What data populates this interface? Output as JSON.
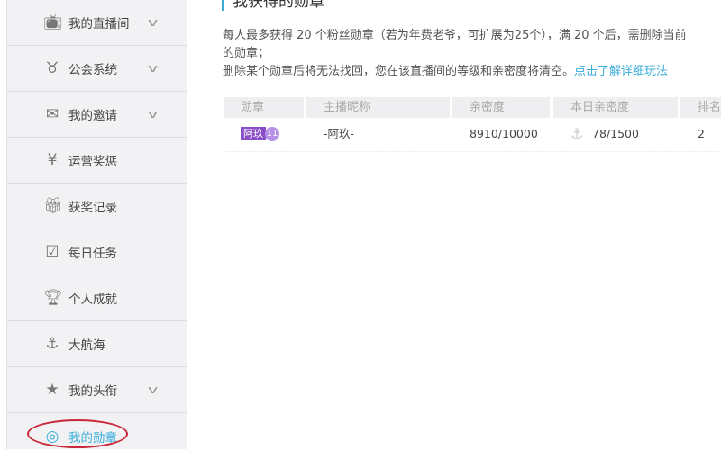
{
  "sidebar": {
    "items": [
      {
        "label": "我的直播间",
        "icon": "tv-icon",
        "chevron": true
      },
      {
        "label": "公会系统",
        "icon": "guild-icon",
        "chevron": true
      },
      {
        "label": "我的邀请",
        "icon": "invite-icon",
        "chevron": true
      },
      {
        "label": "运营奖惩",
        "icon": "money-bag-icon",
        "chevron": false
      },
      {
        "label": "获奖记录",
        "icon": "gift-icon",
        "chevron": false
      },
      {
        "label": "每日任务",
        "icon": "calendar-check-icon",
        "chevron": false
      },
      {
        "label": "个人成就",
        "icon": "trophy-icon",
        "chevron": false
      },
      {
        "label": "大航海",
        "icon": "anchor-icon",
        "chevron": false
      },
      {
        "label": "我的头衔",
        "icon": "star-shield-icon",
        "chevron": true
      },
      {
        "label": "我的勋章",
        "icon": "medal-icon",
        "chevron": false,
        "active": true
      }
    ]
  },
  "main": {
    "title": "我获得的勋章",
    "desc_line1": "每人最多获得 20 个粉丝勋章（若为年费老爷，可扩展为25个），满 20 个后，需删除当前",
    "desc_line2": "的勋章；",
    "desc_line3": "删除某个勋章后将无法找回，您在该直播间的等级和亲密度将清空。",
    "link": "点击了解详细玩法",
    "table": {
      "headers": [
        "勋章",
        "主播昵称",
        "亲密度",
        "本日亲密度",
        "排名"
      ],
      "rows": [
        {
          "badge_name": "阿玖",
          "badge_level": "11",
          "anchor": "-阿玖-",
          "intimacy": "8910/10000",
          "today": "78/1500",
          "rank": "2"
        }
      ]
    }
  },
  "colors": {
    "accent": "#3aaed8",
    "badge": "#8a4fc8",
    "highlight_ring": "#c8283a"
  }
}
